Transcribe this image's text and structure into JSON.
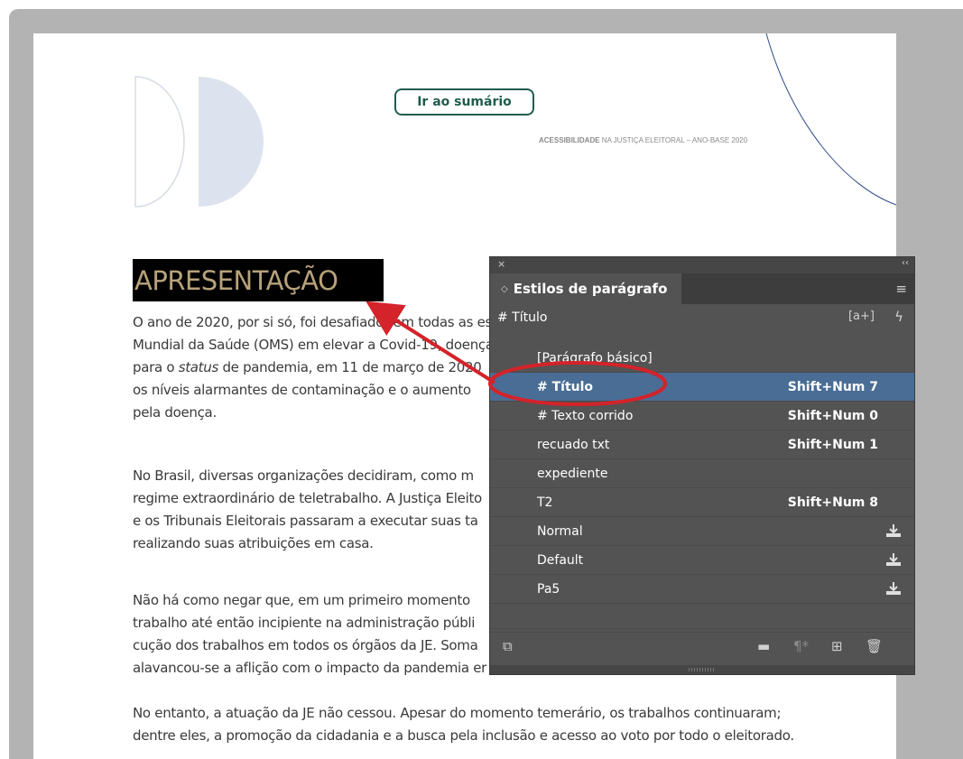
{
  "document": {
    "summary_button": "Ir ao sumário",
    "header_bold": "ACESSIBILIDADE",
    "header_rest": " NA JUSTIÇA ELEITORAL – ANO-BASE 2020",
    "heading": "APRESENTAÇÃO",
    "paragraph1": [
      "O ano de 2020, por si só, foi desafiador em todas as es",
      "Mundial da Saúde (OMS) em elevar a Covid-19, doença",
      "para o status de pandemia, em 11 de março de 2020",
      "os níveis alarmantes de contaminação e o aumento",
      "pela doença."
    ],
    "paragraph2": [
      "No Brasil, diversas organizações decidiram, como m",
      "regime extraordinário de teletrabalho. A Justiça Eleito",
      "e os Tribunais Eleitorais passaram a executar suas ta",
      "realizando suas atribuições em casa."
    ],
    "paragraph3": [
      "Não há como negar que, em um primeiro momento",
      "trabalho até então incipiente na administração públi",
      "cução dos trabalhos em todos os órgãos da JE. Soma",
      "alavancou-se a aflição com o impacto da pandemia er"
    ],
    "paragraph4": [
      "No entanto, a atuação da JE não cessou. Apesar do momento temerário, os trabalhos continuaram;",
      "dentre eles, a promoção da cidadania e a busca pela inclusão e acesso ao voto por todo o eleitorado."
    ]
  },
  "panel": {
    "close_glyph": "×",
    "collapse_glyph": "‹‹",
    "tab_title": "Estilos de parágrafo",
    "current_style": "# Título",
    "styles": [
      {
        "name": "[Parágrafo básico]",
        "shortcut": "",
        "import": false,
        "selected": false
      },
      {
        "name": "# Título",
        "shortcut": "Shift+Num 7",
        "import": false,
        "selected": true
      },
      {
        "name": "# Texto corrido",
        "shortcut": "Shift+Num 0",
        "import": false,
        "selected": false
      },
      {
        "name": "recuado txt",
        "shortcut": "Shift+Num 1",
        "import": false,
        "selected": false
      },
      {
        "name": "expediente",
        "shortcut": "",
        "import": false,
        "selected": false
      },
      {
        "name": "T2",
        "shortcut": "Shift+Num 8",
        "import": false,
        "selected": false
      },
      {
        "name": "Normal",
        "shortcut": "",
        "import": true,
        "selected": false
      },
      {
        "name": "Default",
        "shortcut": "",
        "import": true,
        "selected": false
      },
      {
        "name": "Pa5",
        "shortcut": "",
        "import": true,
        "selected": false
      }
    ]
  },
  "colors": {
    "annotation": "#d4232a",
    "selection": "#4a6d95",
    "heading_text": "#b8a27c",
    "summary_green": "#1f5d4e"
  }
}
